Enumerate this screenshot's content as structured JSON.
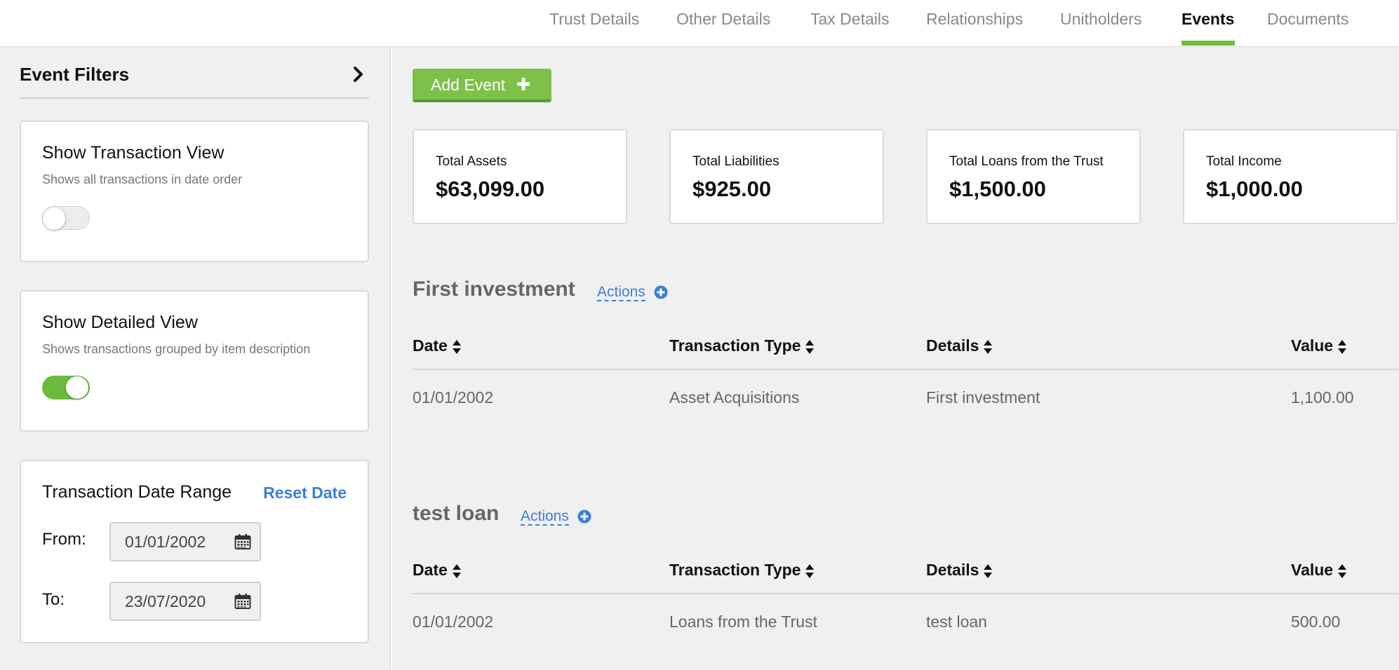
{
  "tabs": [
    {
      "label": "Trust Details",
      "active": false
    },
    {
      "label": "Other Details",
      "active": false
    },
    {
      "label": "Tax Details",
      "active": false
    },
    {
      "label": "Relationships",
      "active": false
    },
    {
      "label": "Unitholders",
      "active": false
    },
    {
      "label": "Events",
      "active": true
    },
    {
      "label": "Documents",
      "active": false
    }
  ],
  "sidebar": {
    "title": "Event Filters",
    "transaction_view": {
      "title": "Show Transaction View",
      "subtitle": "Shows all transactions in date order",
      "enabled": false
    },
    "detailed_view": {
      "title": "Show Detailed View",
      "subtitle": "Shows transactions grouped by item description",
      "enabled": true
    },
    "date_range": {
      "title": "Transaction Date Range",
      "reset_label": "Reset Date",
      "from_label": "From:",
      "from_value": "01/01/2002",
      "to_label": "To:",
      "to_value": "23/07/2020"
    }
  },
  "main": {
    "add_event_label": "Add Event",
    "stats": [
      {
        "label": "Total Assets",
        "value": "$63,099.00"
      },
      {
        "label": "Total Liabilities",
        "value": "$925.00"
      },
      {
        "label": "Total Loans from the Trust",
        "value": "$1,500.00"
      },
      {
        "label": "Total Income",
        "value": "$1,000.00"
      }
    ],
    "columns": [
      "Date",
      "Transaction Type",
      "Details",
      "Value"
    ],
    "sections": [
      {
        "title": "First investment",
        "actions_label": "Actions",
        "rows": [
          {
            "date": "01/01/2002",
            "type": "Asset Acquisitions",
            "details": "First investment",
            "value": "1,100.00"
          }
        ]
      },
      {
        "title": "test loan",
        "actions_label": "Actions",
        "rows": [
          {
            "date": "01/01/2002",
            "type": "Loans from the Trust",
            "details": "test loan",
            "value": "500.00"
          }
        ]
      }
    ]
  },
  "colors": {
    "accent_green": "#6cbb3c",
    "link_blue": "#3b7fd8"
  },
  "icons": [
    "chevron-right-icon",
    "calendar-icon",
    "plus-icon",
    "plus-circle-icon",
    "sort-icon"
  ]
}
